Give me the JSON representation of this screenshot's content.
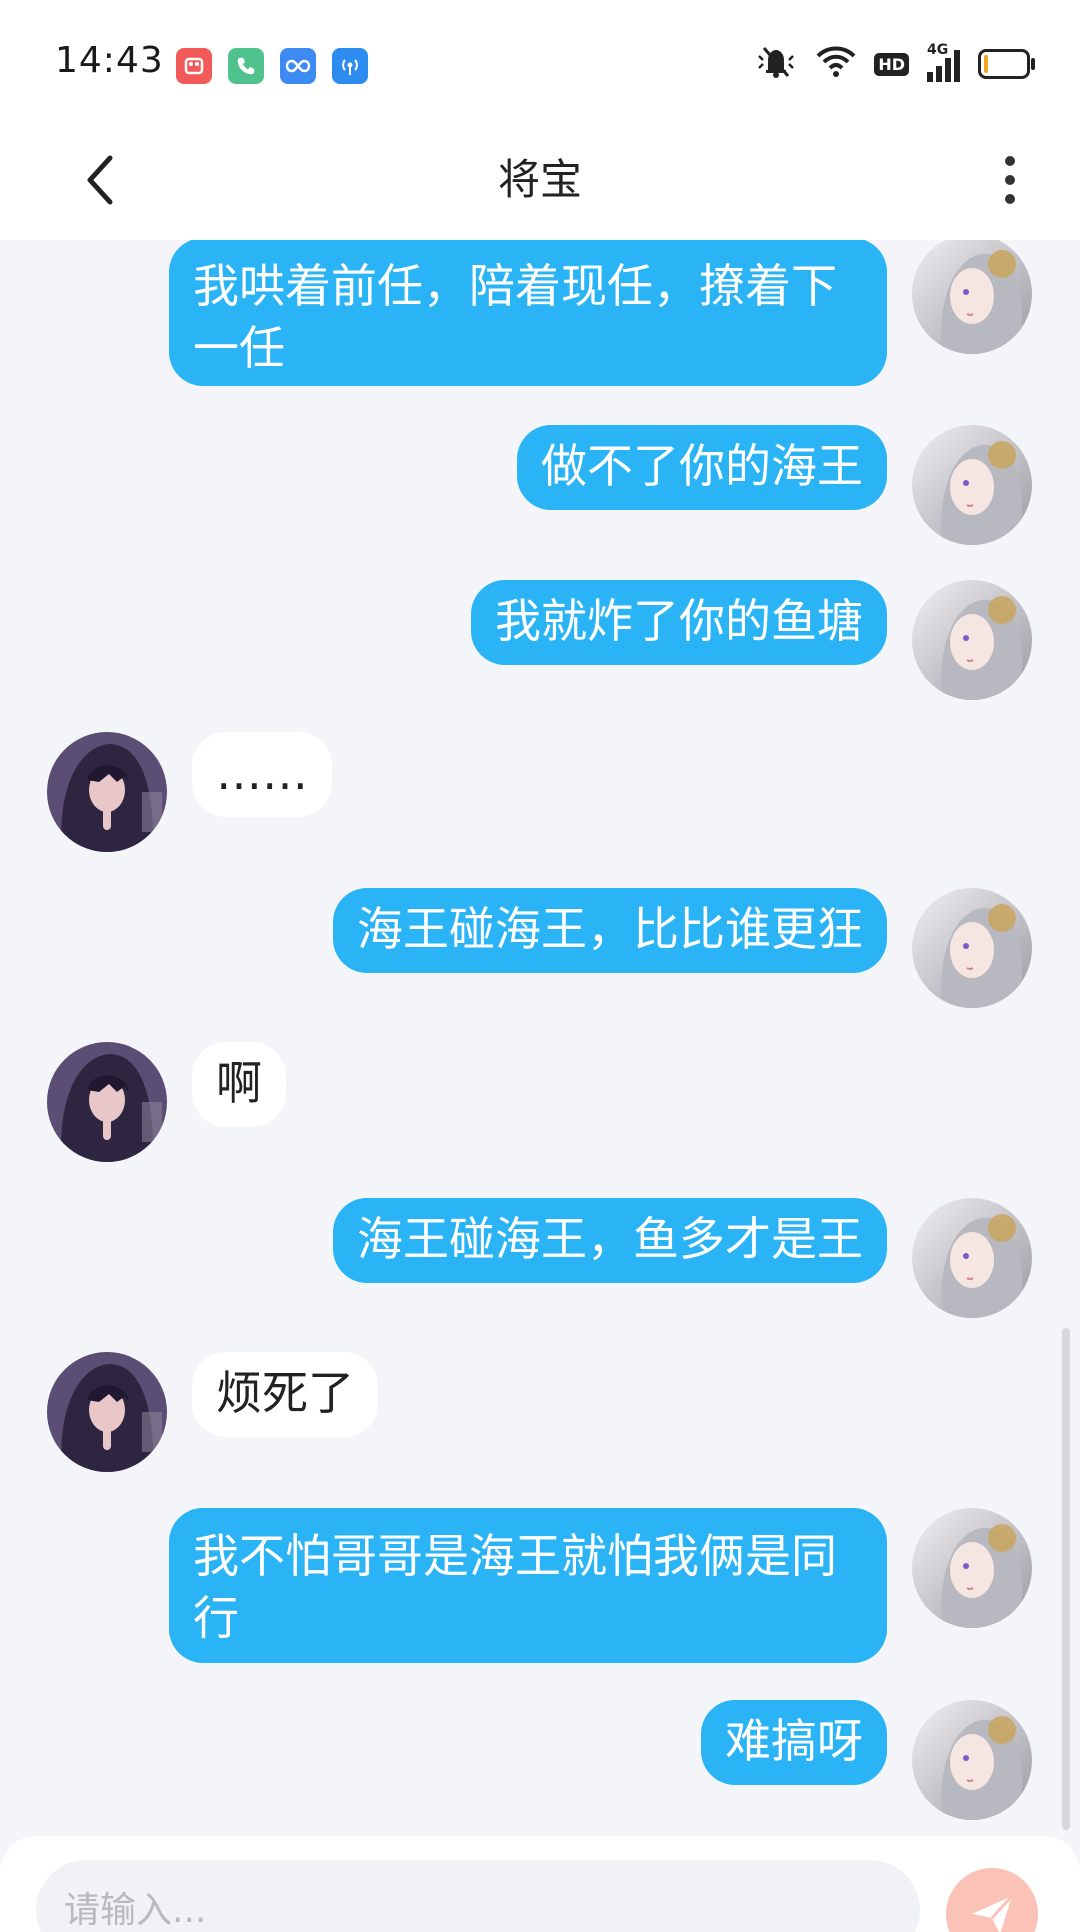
{
  "status_bar": {
    "time": "14:43",
    "hd_label": "HD",
    "network_label": "4G",
    "icons": [
      "app-store-icon",
      "phone-icon",
      "infinity-icon",
      "hotspot-icon",
      "mute-icon",
      "wifi-icon",
      "hd-icon",
      "signal-icon",
      "battery-icon"
    ],
    "battery_level": 0.1,
    "colors": {
      "app1": "#F25A5A",
      "app2": "#4FC28E",
      "app3": "#3D8BF2",
      "app4": "#2E8BEF",
      "battery_fill": "#F5A623"
    }
  },
  "header": {
    "title": "将宝",
    "back_icon": "chevron-left-icon",
    "more_icon": "more-vertical-icon"
  },
  "messages": [
    {
      "sender": "me",
      "text": "我哄着前任，陪着现任，撩着下一任"
    },
    {
      "sender": "me",
      "text": "做不了你的海王"
    },
    {
      "sender": "me",
      "text": "我就炸了你的鱼塘"
    },
    {
      "sender": "other",
      "text": "……"
    },
    {
      "sender": "me",
      "text": "海王碰海王，比比谁更狂"
    },
    {
      "sender": "other",
      "text": "啊"
    },
    {
      "sender": "me",
      "text": "海王碰海王，鱼多才是王"
    },
    {
      "sender": "other",
      "text": "烦死了"
    },
    {
      "sender": "me",
      "text": "我不怕哥哥是海王就怕我俩是同行"
    },
    {
      "sender": "me",
      "text": "难搞呀"
    }
  ],
  "composer": {
    "placeholder": "请输入...",
    "value": "",
    "send_icon": "send-icon"
  },
  "colors": {
    "me_bubble": "#2AB4F6",
    "other_bubble": "#FFFFFF",
    "background": "#F3F5F8",
    "send_button": "#FBC2B7"
  }
}
